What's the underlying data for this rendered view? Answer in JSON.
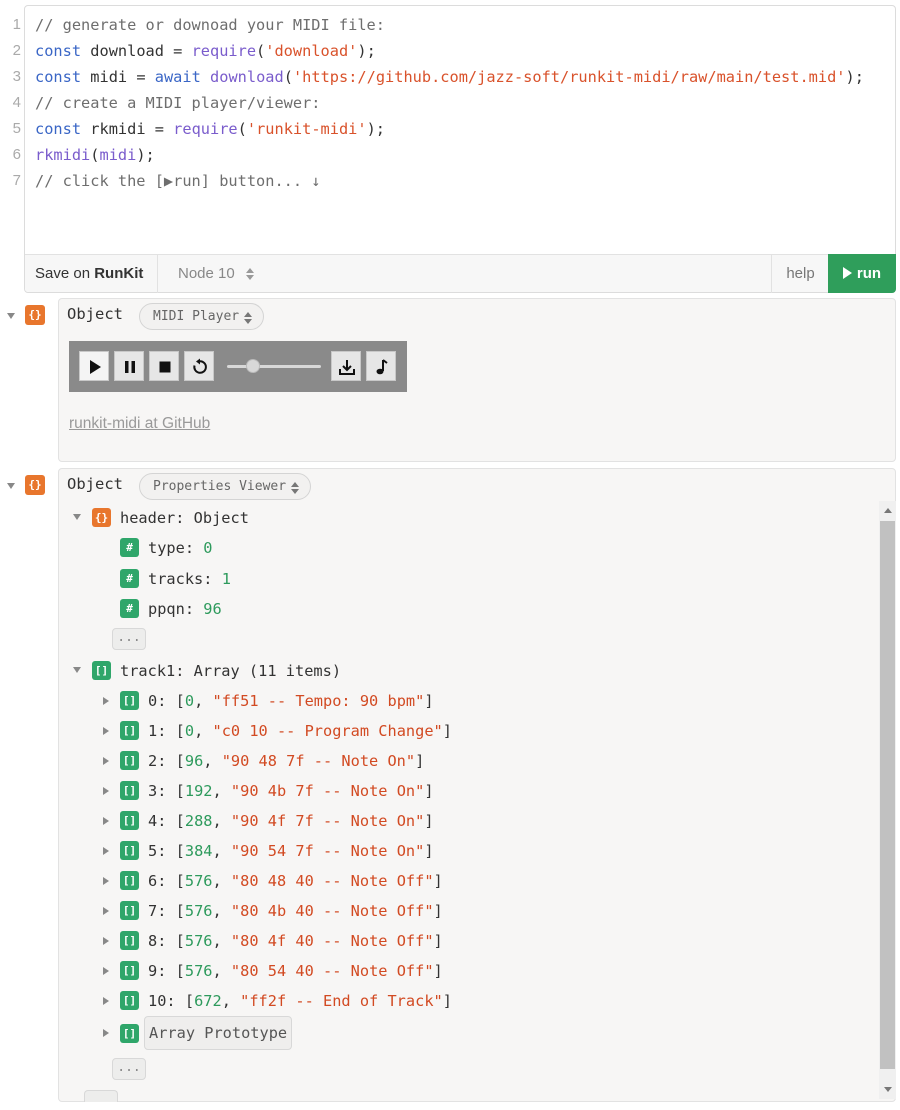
{
  "editor": {
    "line_numbers": [
      "1",
      "2",
      "3",
      "4",
      "5",
      "6",
      "7"
    ],
    "lines": [
      [
        {
          "t": "comment",
          "v": "// generate or downoad your MIDI file:"
        }
      ],
      [
        {
          "t": "kw",
          "v": "const"
        },
        {
          "t": "plain",
          "v": " download = "
        },
        {
          "t": "fn",
          "v": "require"
        },
        {
          "t": "plain",
          "v": "("
        },
        {
          "t": "str",
          "v": "'download'"
        },
        {
          "t": "plain",
          "v": ");"
        }
      ],
      [
        {
          "t": "kw",
          "v": "const"
        },
        {
          "t": "plain",
          "v": " midi = "
        },
        {
          "t": "kw",
          "v": "await"
        },
        {
          "t": "plain",
          "v": " "
        },
        {
          "t": "fn",
          "v": "download"
        },
        {
          "t": "plain",
          "v": "("
        },
        {
          "t": "str",
          "v": "'https://github.com/jazz-soft/runkit-midi/raw/main/test.mid'"
        },
        {
          "t": "plain",
          "v": ");"
        }
      ],
      [
        {
          "t": "comment",
          "v": "// create a MIDI player/viewer:"
        }
      ],
      [
        {
          "t": "kw",
          "v": "const"
        },
        {
          "t": "plain",
          "v": " rkmidi = "
        },
        {
          "t": "fn",
          "v": "require"
        },
        {
          "t": "plain",
          "v": "("
        },
        {
          "t": "str",
          "v": "'runkit-midi'"
        },
        {
          "t": "plain",
          "v": ");"
        }
      ],
      [
        {
          "t": "fn",
          "v": "rkmidi"
        },
        {
          "t": "plain",
          "v": "("
        },
        {
          "t": "fn",
          "v": "midi"
        },
        {
          "t": "plain",
          "v": ");"
        }
      ],
      [
        {
          "t": "comment",
          "v": "// click the [▶run] button... ↓"
        }
      ]
    ]
  },
  "toolbar": {
    "save_prefix": "Save on ",
    "save_brand": "RunKit",
    "node_version": "Node 10",
    "help_label": "help",
    "run_label": "run"
  },
  "player_cell": {
    "title": "Object",
    "viewer": "MIDI Player",
    "link_text": "runkit-midi at GitHub",
    "slider_position": 0.28
  },
  "props_cell": {
    "title": "Object",
    "viewer": "Properties Viewer",
    "badge_obj": "{}",
    "badge_num": "#",
    "badge_arr": "[]",
    "header_label": "header: Object",
    "header_fields": [
      {
        "key": "type",
        "value": "0"
      },
      {
        "key": "tracks",
        "value": "1"
      },
      {
        "key": "ppqn",
        "value": "96"
      }
    ],
    "ellipsis": "...",
    "track_label": "track1: Array (11 items)",
    "track_items": [
      {
        "idx": "0",
        "time": "0",
        "msg": "\"ff51 -- Tempo: 90 bpm\""
      },
      {
        "idx": "1",
        "time": "0",
        "msg": "\"c0 10 -- Program Change\""
      },
      {
        "idx": "2",
        "time": "96",
        "msg": "\"90 48 7f -- Note On\""
      },
      {
        "idx": "3",
        "time": "192",
        "msg": "\"90 4b 7f -- Note On\""
      },
      {
        "idx": "4",
        "time": "288",
        "msg": "\"90 4f 7f -- Note On\""
      },
      {
        "idx": "5",
        "time": "384",
        "msg": "\"90 54 7f -- Note On\""
      },
      {
        "idx": "6",
        "time": "576",
        "msg": "\"80 48 40 -- Note Off\""
      },
      {
        "idx": "7",
        "time": "576",
        "msg": "\"80 4b 40 -- Note Off\""
      },
      {
        "idx": "8",
        "time": "576",
        "msg": "\"80 4f 40 -- Note Off\""
      },
      {
        "idx": "9",
        "time": "576",
        "msg": "\"80 54 40 -- Note Off\""
      },
      {
        "idx": "10",
        "time": "672",
        "msg": "\"ff2f -- End of Track\""
      }
    ],
    "prototype_label": "Array Prototype"
  },
  "colors": {
    "run_button": "#2f9e5b",
    "object_badge": "#e8762d",
    "number_badge": "#2fa66a",
    "string_value": "#d24a22",
    "number_value": "#2d9a5c"
  }
}
